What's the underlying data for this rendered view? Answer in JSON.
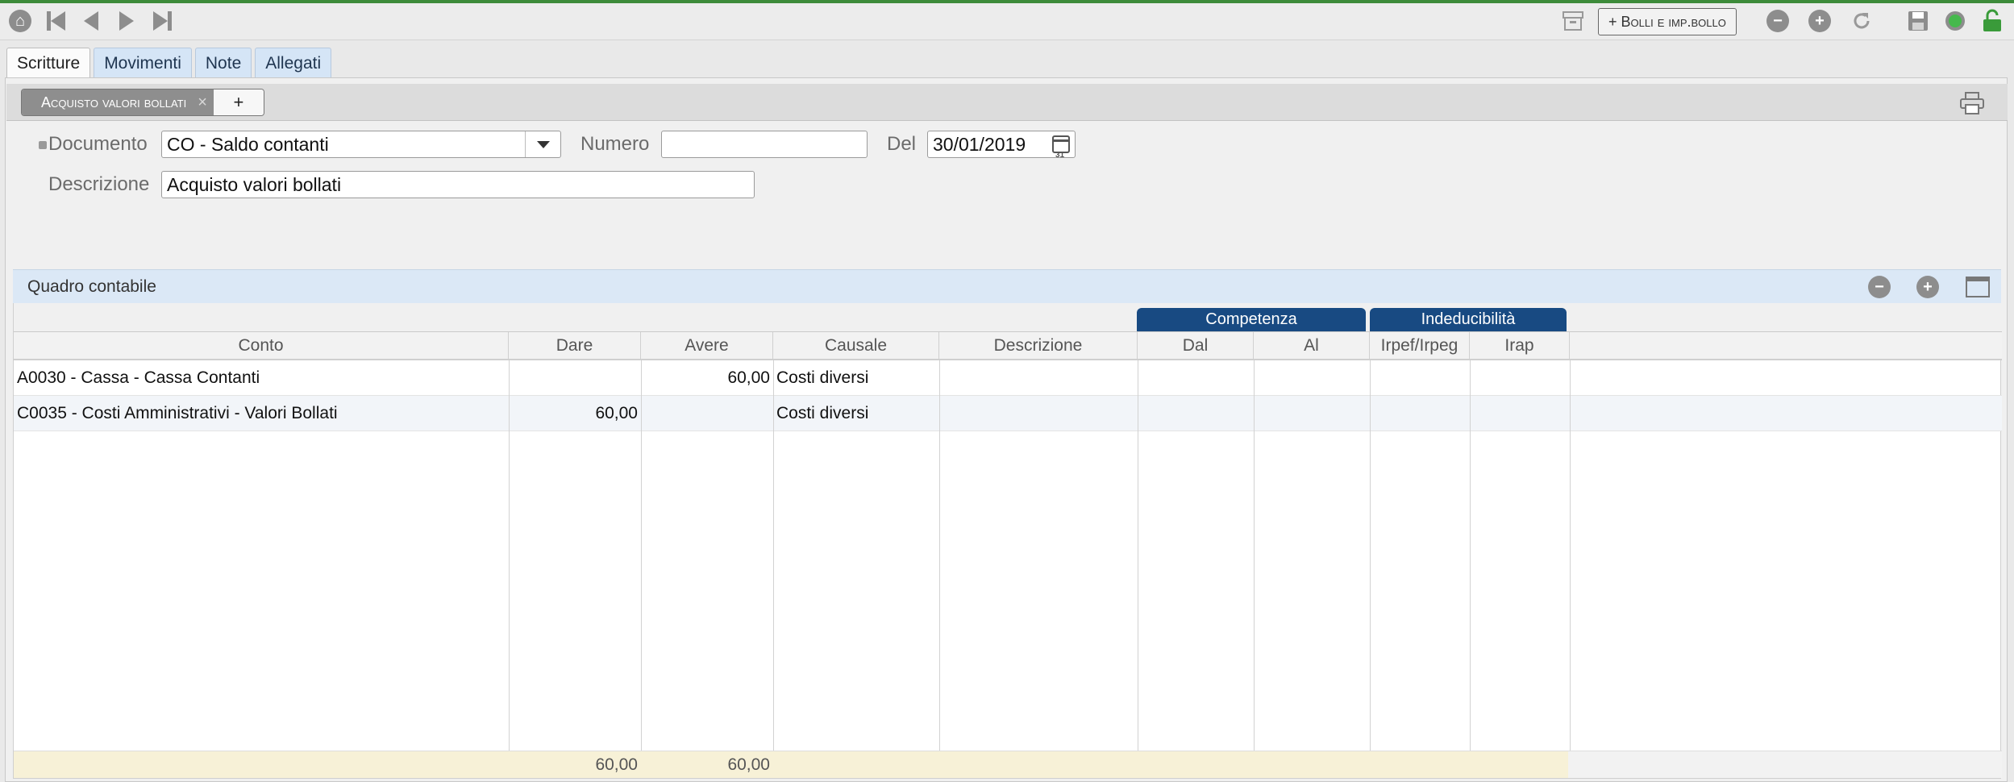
{
  "toolbar": {
    "bolli_button": "+ Bolli e imp.bollo",
    "icons": [
      "home-icon",
      "first-icon",
      "prev-icon",
      "next-icon",
      "last-icon",
      "archive-icon",
      "remove-icon",
      "add-icon",
      "refresh-icon",
      "save-icon",
      "status-icon",
      "lock-icon"
    ]
  },
  "tabs": [
    {
      "label": "Scritture",
      "active": true
    },
    {
      "label": "Movimenti",
      "active": false
    },
    {
      "label": "Note",
      "active": false
    },
    {
      "label": "Allegati",
      "active": false
    }
  ],
  "doc_tab": {
    "label": "Acquisto valori bollati",
    "close": "×",
    "add": "+"
  },
  "form": {
    "documento_label": "Documento",
    "documento_value": "CO - Saldo contanti",
    "numero_label": "Numero",
    "numero_value": "",
    "del_label": "Del",
    "del_value": "30/01/2019",
    "descrizione_label": "Descrizione",
    "descrizione_value": "Acquisto valori bollati"
  },
  "quadro": {
    "title": "Quadro contabile",
    "groups": {
      "competenza": "Competenza",
      "indeducibilita": "Indeducibilità"
    },
    "columns": [
      "Conto",
      "Dare",
      "Avere",
      "Causale",
      "Descrizione",
      "Dal",
      "Al",
      "Irpef/Irpeg",
      "Irap"
    ],
    "rows": [
      {
        "conto": "A0030 - Cassa - Cassa Contanti",
        "dare": "",
        "avere": "60,00",
        "causale": "Costi diversi",
        "descrizione": "",
        "dal": "",
        "al": "",
        "irpef": "",
        "irap": ""
      },
      {
        "conto": "C0035 - Costi Amministrativi - Valori Bollati",
        "dare": "60,00",
        "avere": "",
        "causale": "Costi diversi",
        "descrizione": "",
        "dal": "",
        "al": "",
        "irpef": "",
        "irap": ""
      }
    ],
    "totals": {
      "dare": "60,00",
      "avere": "60,00"
    }
  },
  "colors": {
    "accent_green": "#3d8b3a",
    "group_header": "#184a82",
    "tab_bg": "#d5e5f6",
    "totals_bg": "#f7f1d7"
  }
}
